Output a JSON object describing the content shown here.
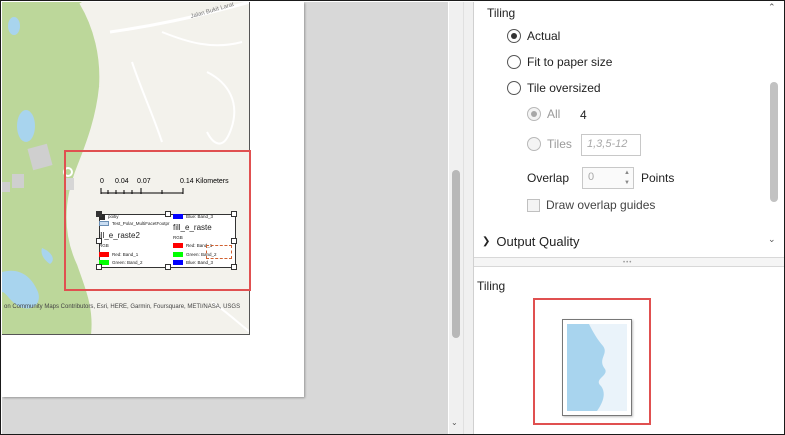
{
  "map": {
    "road_label": "Jalan Bukit Larat",
    "attribution": "on Community Maps Contributors, Esri, HERE, Garmin, Foursquare, METI/NASA, USGS"
  },
  "scale_bar": {
    "ticks": [
      "0",
      "0.04",
      "0.07",
      "0.14 Kilometers"
    ]
  },
  "legend": {
    "col1": [
      {
        "label": "poitiy",
        "color": "#2b2b2b"
      },
      {
        "label": "Test_Polar_MultiFacetFootpr",
        "color": "#c9ddf2"
      },
      {
        "label": "ill_e_raste2",
        "color": ""
      },
      {
        "label": "RGB",
        "color": ""
      },
      {
        "label": "Red: Band_1",
        "color": "#ff0000"
      },
      {
        "label": "Green: Band_2",
        "color": "#00ff00"
      }
    ],
    "col2": [
      {
        "label": "Blue: Band_3",
        "color": "#0000ff"
      },
      {
        "label": "fill_e_raste",
        "color": ""
      },
      {
        "label": "RGB",
        "color": ""
      },
      {
        "label": "Red: Band_1",
        "color": "#ff0000"
      },
      {
        "label": "Green: Band_2",
        "color": "#00ff00"
      },
      {
        "label": "Blue: Band_3",
        "color": "#0000ff"
      }
    ]
  },
  "panel": {
    "tiling_section_label": "Tiling",
    "options": {
      "actual": "Actual",
      "fit": "Fit to paper size",
      "tile_oversized": "Tile oversized"
    },
    "all_label": "All",
    "all_value": "4",
    "tiles_label": "Tiles",
    "tiles_placeholder": "1,3,5-12",
    "overlap_label": "Overlap",
    "overlap_value": "0",
    "overlap_unit": "Points",
    "draw_guides_label": "Draw overlap guides",
    "output_quality_label": "Output Quality",
    "preview_title": "Tiling"
  },
  "colors": {
    "highlight": "#e05050",
    "water": "#a8d4ee",
    "vegetation": "#bcd79a"
  }
}
